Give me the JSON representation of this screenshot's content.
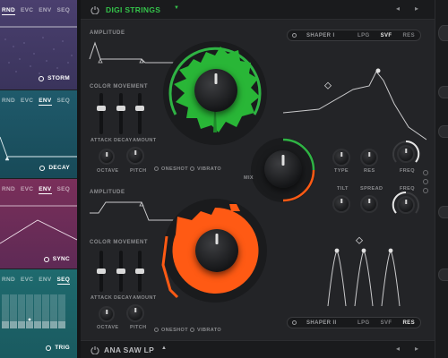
{
  "modulators": [
    {
      "tabs": [
        "RND",
        "EVC",
        "ENV",
        "SEQ"
      ],
      "active": 0,
      "name": "STORM",
      "color": "#4a3f6e"
    },
    {
      "tabs": [
        "RND",
        "EVC",
        "ENV",
        "SEQ"
      ],
      "active": 2,
      "name": "DECAY",
      "color": "#1f5a6b"
    },
    {
      "tabs": [
        "RND",
        "EVC",
        "ENV",
        "SEQ"
      ],
      "active": 2,
      "name": "SYNC",
      "color": "#7a2f5a"
    },
    {
      "tabs": [
        "RND",
        "EVC",
        "ENV",
        "SEQ"
      ],
      "active": 3,
      "name": "TRIG",
      "color": "#1e6a6e"
    }
  ],
  "header": {
    "preset": "DIGI STRINGS",
    "prev": "◂",
    "next": "▸"
  },
  "footer": {
    "preset": "ANA SAW LP",
    "prev": "◂",
    "next": "▸"
  },
  "osc1": {
    "amplitude": "AMPLITUDE",
    "color_movement": "COLOR MOVEMENT",
    "faders": [
      "ATTACK",
      "DECAY",
      "AMOUNT"
    ],
    "octave": "OCTAVE",
    "pitch": "PITCH",
    "oneshot": "ONESHOT",
    "vibrato": "VIBRATO",
    "accent": "#2fb344"
  },
  "osc2": {
    "amplitude": "AMPLITUDE",
    "color_movement": "COLOR MOVEMENT",
    "faders": [
      "ATTACK",
      "DECAY",
      "AMOUNT"
    ],
    "octave": "OCTAVE",
    "pitch": "PITCH",
    "oneshot": "ONESHOT",
    "vibrato": "VIBRATO",
    "accent": "#ff5a14"
  },
  "mix": {
    "label": "MIX"
  },
  "shaper1": {
    "name": "SHAPER I",
    "modes": [
      "LPG",
      "SVF",
      "RES"
    ],
    "active": 1,
    "knobs": [
      "TYPE",
      "RES",
      "FREQ"
    ]
  },
  "shaper2": {
    "name": "SHAPER II",
    "modes": [
      "LPG",
      "SVF",
      "RES"
    ],
    "active": 2,
    "knobs": [
      "TILT",
      "SPREAD",
      "FREQ"
    ]
  }
}
